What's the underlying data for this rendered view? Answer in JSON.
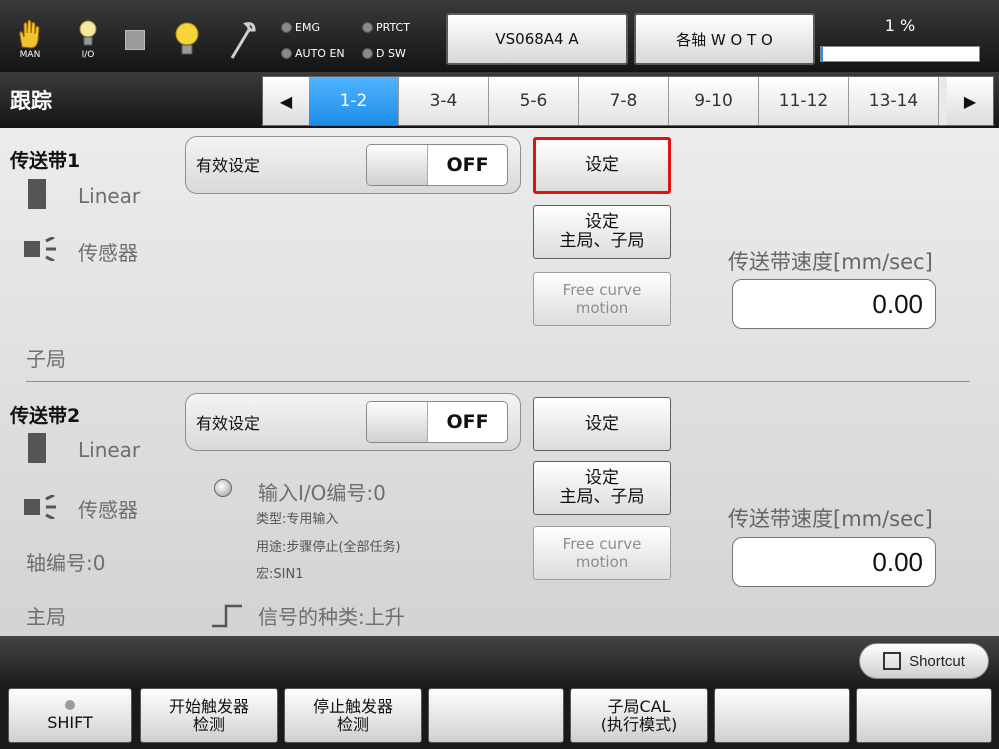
{
  "topbar": {
    "mode_icons": [
      {
        "icon": "hand-icon",
        "label": "MAN"
      },
      {
        "icon": "bulb-icon",
        "label": "I/O"
      },
      {
        "icon": "stop-square-icon",
        "label": ""
      },
      {
        "icon": "bulb-icon",
        "label": ""
      },
      {
        "icon": "wrench-icon",
        "label": ""
      }
    ],
    "leds": [
      "EMG",
      "PRTCT",
      "AUTO EN",
      "D SW"
    ],
    "robot_model": "VS068A4 A",
    "axis_button": "各轴 W O T O",
    "speed_percent": "1 %",
    "speed_fraction": 0.01
  },
  "page_title": "跟踪",
  "tabs": [
    "1-2",
    "3-4",
    "5-6",
    "7-8",
    "9-10",
    "11-12",
    "13-14"
  ],
  "active_tab": 0,
  "conveyor1": {
    "title": "传送带1",
    "type": "Linear",
    "sensor": "传感器",
    "valid_label": "有效设定",
    "toggle": "OFF",
    "set_button": "设定",
    "master_slave_button": [
      "设定",
      "主局、子局"
    ],
    "free_curve_button": [
      "Free curve",
      "motion"
    ],
    "speed_label": "传送带速度[mm/sec]",
    "speed_value": "0.00",
    "role": "子局"
  },
  "conveyor2": {
    "title": "传送带2",
    "type": "Linear",
    "sensor": "传感器",
    "axis_no": "轴编号:0",
    "valid_label": "有效设定",
    "toggle": "OFF",
    "io_number": "输入I/O编号:0",
    "io_type": "类型:专用输入",
    "io_use": "用途:步骤停止(全部任务)",
    "io_macro": "宏:SIN1",
    "signal_type": "信号的种类:上升",
    "set_button": "设定",
    "master_slave_button": [
      "设定",
      "主局、子局"
    ],
    "free_curve_button": [
      "Free curve",
      "motion"
    ],
    "speed_label": "传送带速度[mm/sec]",
    "speed_value": "0.00",
    "role": "主局"
  },
  "shortcut": "Shortcut",
  "function_keys": [
    [
      "SHIFT"
    ],
    [
      "开始触发器",
      "检测"
    ],
    [
      "停止触发器",
      "检测"
    ],
    [
      ""
    ],
    [
      "子局CAL",
      "(执行模式)"
    ],
    [
      ""
    ],
    [
      ""
    ]
  ]
}
